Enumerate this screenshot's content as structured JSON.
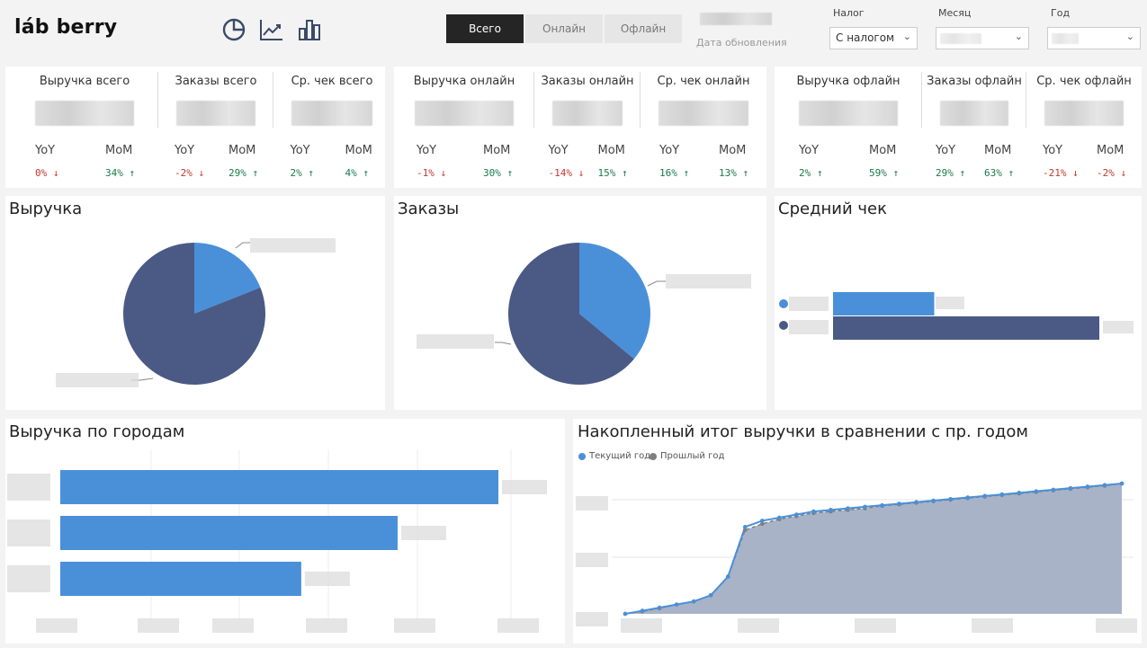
{
  "header": {
    "logo": "láb berry",
    "icons": [
      "pie-chart-icon",
      "trend-chart-icon",
      "bar-chart-icon"
    ],
    "segments": [
      "Всего",
      "Онлайн",
      "Офлайн"
    ],
    "active_segment": "Всего",
    "update_label": "Дата обновления",
    "filters": [
      {
        "label": "Налог",
        "value": "С налогом"
      },
      {
        "label": "Месяц",
        "value": ""
      },
      {
        "label": "Год",
        "value": ""
      }
    ]
  },
  "kpi_groups": [
    {
      "items": [
        {
          "title": "Выручка всего",
          "yoy": "0%",
          "yoy_dir": "↓",
          "mom": "34%",
          "mom_dir": "↑"
        },
        {
          "title": "Заказы всего",
          "yoy": "-2%",
          "yoy_dir": "↓",
          "mom": "29%",
          "mom_dir": "↑"
        },
        {
          "title": "Ср. чек всего",
          "yoy": "2%",
          "yoy_dir": "↑",
          "mom": "4%",
          "mom_dir": "↑"
        }
      ]
    },
    {
      "items": [
        {
          "title": "Выручка онлайн",
          "yoy": "-1%",
          "yoy_dir": "↓",
          "mom": "30%",
          "mom_dir": "↑"
        },
        {
          "title": "Заказы онлайн",
          "yoy": "-14%",
          "yoy_dir": "↓",
          "mom": "15%",
          "mom_dir": "↑"
        },
        {
          "title": "Ср. чек онлайн",
          "yoy": "16%",
          "yoy_dir": "↑",
          "mom": "13%",
          "mom_dir": "↑"
        }
      ]
    },
    {
      "items": [
        {
          "title": "Выручка офлайн",
          "yoy": "2%",
          "yoy_dir": "↑",
          "mom": "59%",
          "mom_dir": "↑"
        },
        {
          "title": "Заказы офлайн",
          "yoy": "29%",
          "yoy_dir": "↑",
          "mom": "63%",
          "mom_dir": "↑"
        },
        {
          "title": "Ср. чек офлайн",
          "yoy": "-21%",
          "yoy_dir": "↓",
          "mom": "-2%",
          "mom_dir": "↓"
        }
      ]
    }
  ],
  "kpi_labels": {
    "yoy": "YoY",
    "mom": "MoM"
  },
  "colors": {
    "online": "#4a90d9",
    "offline": "#4a5a85",
    "up": "#1a7a4a",
    "down": "#c0392b",
    "prev_area": "#a8b3c7"
  },
  "charts": {
    "revenue_title": "Выручка",
    "orders_title": "Заказы",
    "avg_check_title": "Средний чек",
    "cities_title": "Выручка по городам",
    "cumulative_title": "Накопленный итог выручки в сравнении с пр. годом",
    "legend_current": "Текущий год",
    "legend_previous": "Прошлый год"
  },
  "chart_data": [
    {
      "type": "pie",
      "title": "Выручка",
      "values": [
        0.19,
        0.81
      ]
    },
    {
      "type": "pie",
      "title": "Заказы",
      "values": [
        0.36,
        0.64
      ]
    },
    {
      "type": "bar",
      "title": "Средний чек",
      "values": [
        0.38,
        1.0
      ]
    },
    {
      "type": "bar",
      "title": "Выручка по городам",
      "values": [
        1.0,
        0.77,
        0.55
      ]
    },
    {
      "type": "area",
      "title": "Накопленный итог выручки в сравнении с пр. годом",
      "series": [
        {
          "name": "Текущий год",
          "values": [
            0,
            1,
            2,
            3,
            4,
            6,
            12,
            28,
            30,
            31,
            32,
            33,
            33.5,
            34,
            34.5,
            35,
            35.5,
            36,
            36.5,
            37,
            37.5,
            38,
            38.5,
            39,
            39.5,
            40,
            40.5,
            41,
            41.5,
            42
          ]
        },
        {
          "name": "Прошлый год",
          "values": [
            0,
            0.8,
            1.8,
            3,
            4,
            6,
            12,
            27,
            29,
            30.5,
            31.5,
            32.5,
            33,
            33.5,
            34,
            34.8,
            35.3,
            35.8,
            36.3,
            36.8,
            37.3,
            37.8,
            38.3,
            38.8,
            39.3,
            39.8,
            40.3,
            40.8,
            41.3,
            42
          ]
        }
      ]
    }
  ]
}
